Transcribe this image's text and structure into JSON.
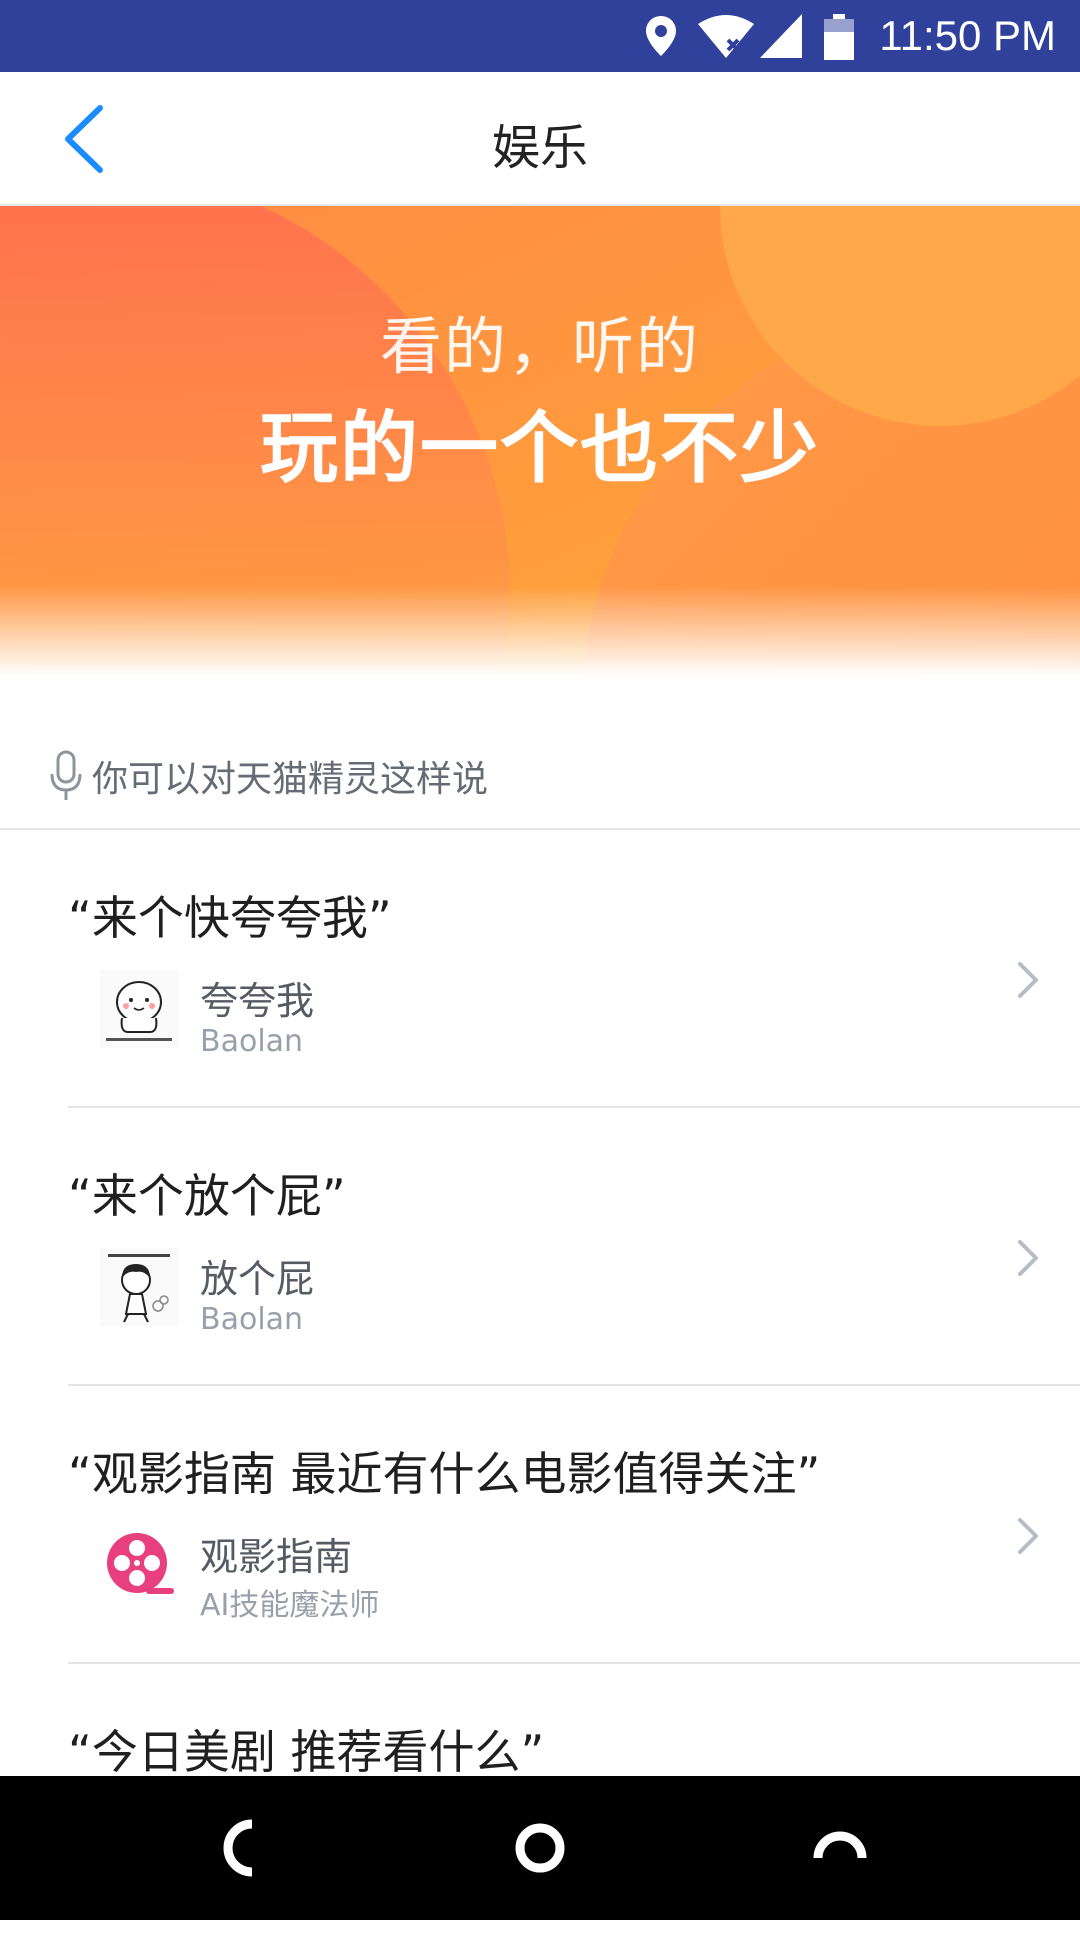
{
  "status_bar": {
    "time": "11:50 PM",
    "icons": [
      "location-icon",
      "wifi-icon",
      "signal-icon",
      "battery-icon"
    ],
    "background": "#30419c"
  },
  "header": {
    "title": "娱乐",
    "back_icon": "chevron-left-icon",
    "accent": "#1a8cff"
  },
  "banner": {
    "line1": "看的，听的",
    "line2": "玩的一个也不少"
  },
  "hint": {
    "icon": "microphone-icon",
    "text": "你可以对天猫精灵这样说"
  },
  "items": [
    {
      "quote": "“来个快夸夸我”",
      "name": "夸夸我",
      "author": "Baolan",
      "thumb_icon": "cartoon-face-icon"
    },
    {
      "quote": "“来个放个屁”",
      "name": "放个屁",
      "author": "Baolan",
      "thumb_icon": "cartoon-character-icon"
    },
    {
      "quote": "“观影指南 最近有什么电影值得关注”",
      "name": "观影指南",
      "author": "AI技能魔法师",
      "thumb_icon": "film-reel-icon"
    },
    {
      "quote": "“今日美剧 推荐看什么”"
    }
  ],
  "nav_bar": {
    "icons": [
      "back-nav-icon",
      "home-nav-icon",
      "recents-nav-icon"
    ]
  }
}
